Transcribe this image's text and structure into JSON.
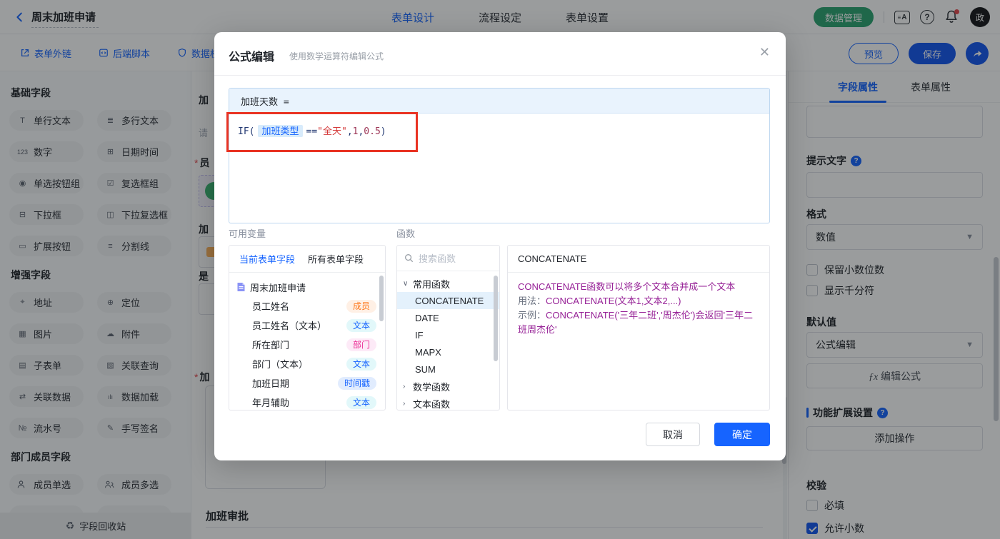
{
  "colors": {
    "accent": "#1664ff",
    "green": "#2ba471",
    "annotation_red": "#e93323",
    "string_red": "#d43a3a",
    "desc_purple": "#962096"
  },
  "topbar": {
    "title": "周末加班申请",
    "tabs": [
      {
        "label": "表单设计"
      },
      {
        "label": "流程设定"
      },
      {
        "label": "表单设置"
      }
    ],
    "data_manage_label": "数据管理",
    "avatar_text": "政",
    "icons": {
      "back": "chevron-left",
      "doc_a": "form-template",
      "help": "?",
      "bell": "notification"
    }
  },
  "toolbar": {
    "links": [
      {
        "label": "表单外链"
      },
      {
        "label": "后端脚本"
      },
      {
        "label": "数据权"
      }
    ],
    "preview_label": "预览",
    "save_label": "保存",
    "share_icon": "share-arrow"
  },
  "sidebar": {
    "sections": [
      {
        "title": "基础字段",
        "items": [
          {
            "icon": "T",
            "label": "单行文本"
          },
          {
            "icon": "≣",
            "label": "多行文本"
          },
          {
            "icon": "123",
            "label": "数字"
          },
          {
            "icon": "⊞",
            "label": "日期时间"
          },
          {
            "icon": "◉",
            "label": "单选按钮组"
          },
          {
            "icon": "☑",
            "label": "复选框组"
          },
          {
            "icon": "⊟",
            "label": "下拉框"
          },
          {
            "icon": "◫",
            "label": "下拉复选框"
          },
          {
            "icon": "▭",
            "label": "扩展按钮"
          },
          {
            "icon": "≡",
            "label": "分割线"
          }
        ]
      },
      {
        "title": "增强字段",
        "items": [
          {
            "icon": "⌖",
            "label": "地址"
          },
          {
            "icon": "⊕",
            "label": "定位"
          },
          {
            "icon": "▦",
            "label": "图片"
          },
          {
            "icon": "☁",
            "label": "附件"
          },
          {
            "icon": "▤",
            "label": "子表单"
          },
          {
            "icon": "▧",
            "label": "关联查询"
          },
          {
            "icon": "⇄",
            "label": "关联数据"
          },
          {
            "icon": "ılı",
            "label": "数据加载"
          },
          {
            "icon": "№",
            "label": "流水号"
          },
          {
            "icon": "✎",
            "label": "手写签名"
          }
        ]
      },
      {
        "title": "部门成员字段",
        "items": [
          {
            "icon": "person",
            "label": "成员单选"
          },
          {
            "icon": "people",
            "label": "成员多选"
          }
        ]
      }
    ],
    "recycle_label": "字段回收站",
    "recycle_icon": "♻"
  },
  "canvas": {
    "required_mark": "*",
    "clipped_labels": [
      "加",
      "请",
      "员",
      "加",
      "是",
      "加"
    ],
    "section_title": "加班审批"
  },
  "right_panel": {
    "tabs": [
      {
        "label": "字段属性"
      },
      {
        "label": "表单属性"
      }
    ],
    "hint_label": "提示文字",
    "format_label": "格式",
    "format_value": "数值",
    "keep_decimal_label": "保留小数位数",
    "thousand_sep_label": "显示千分符",
    "default_label": "默认值",
    "default_value": "公式编辑",
    "fx_prefix": "ƒx",
    "fx_button_label": "编辑公式",
    "ext_title": "功能扩展设置",
    "add_action_label": "添加操作",
    "validate_title": "校验",
    "required_label": "必填",
    "allow_decimal_label": "允许小数"
  },
  "modal": {
    "title": "公式编辑",
    "subtitle": "使用数学运算符编辑公式",
    "close_icon": "✕",
    "editor": {
      "target": "加班天数 =",
      "formula": {
        "kw": "IF(",
        "variable": "加班类型",
        "op": "==",
        "str": "\"全天\"",
        "c1": ",",
        "n1": "1",
        "c2": ",",
        "n2": "0.5",
        "close": ")"
      }
    },
    "variables": {
      "label": "可用变量",
      "tabs": [
        {
          "label": "当前表单字段"
        },
        {
          "label": "所有表单字段"
        }
      ],
      "form_name": "周末加班申请",
      "fields": [
        {
          "name": "员工姓名",
          "badge": "成员"
        },
        {
          "name": "员工姓名（文本）",
          "badge": "文本"
        },
        {
          "name": "所在部门",
          "badge": "部门"
        },
        {
          "name": "部门（文本）",
          "badge": "文本"
        },
        {
          "name": "加班日期",
          "badge": "时间戳"
        },
        {
          "name": "年月辅助",
          "badge": "文本"
        }
      ]
    },
    "functions": {
      "label": "函数",
      "search_placeholder": "搜索函数",
      "group_common": "常用函数",
      "items": [
        "CONCATENATE",
        "DATE",
        "IF",
        "MAPX",
        "SUM"
      ],
      "selected": "CONCATENATE",
      "group_math": "数学函数",
      "group_text": "文本函数"
    },
    "description": {
      "title": "CONCATENATE",
      "line1": "CONCATENATE函数可以将多个文本合并成一个文本",
      "usage_prefix": "用法：",
      "usage": "CONCATENATE(文本1,文本2,...)",
      "example_prefix": "示例：",
      "example": "CONCATENATE('三年二班','周杰伦')会返回'三年二班周杰伦'"
    },
    "cancel_label": "取消",
    "confirm_label": "确定"
  }
}
